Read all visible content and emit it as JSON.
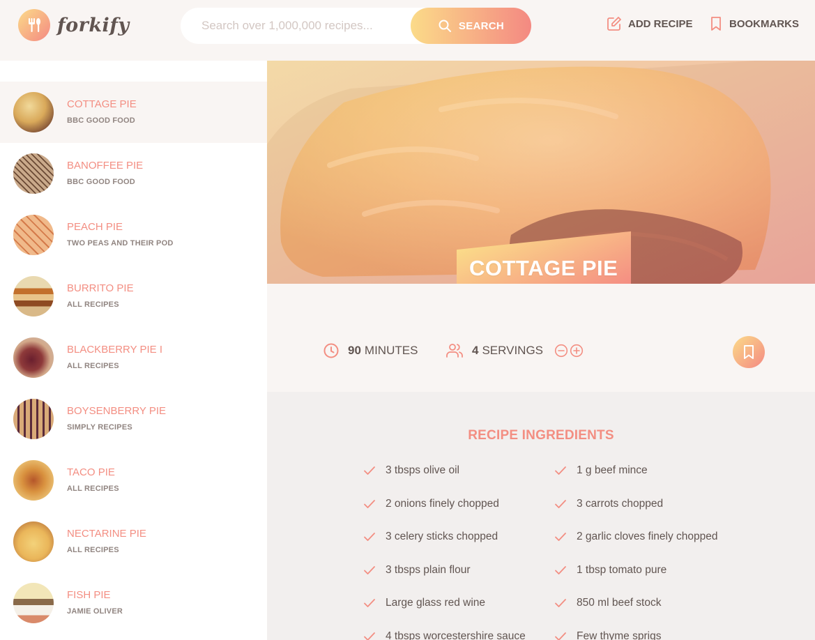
{
  "app": {
    "logo_text": "forkify"
  },
  "search": {
    "placeholder": "Search over 1,000,000 recipes...",
    "button_label": "SEARCH"
  },
  "nav": {
    "add_recipe": "ADD RECIPE",
    "bookmarks": "BOOKMARKS"
  },
  "results": [
    {
      "title": "COTTAGE PIE",
      "publisher": "BBC GOOD FOOD",
      "active": true
    },
    {
      "title": "BANOFFEE PIE",
      "publisher": "BBC GOOD FOOD"
    },
    {
      "title": "PEACH PIE",
      "publisher": "TWO PEAS AND THEIR POD"
    },
    {
      "title": "BURRITO PIE",
      "publisher": "ALL RECIPES"
    },
    {
      "title": "BLACKBERRY PIE I",
      "publisher": "ALL RECIPES"
    },
    {
      "title": "BOYSENBERRY PIE",
      "publisher": "SIMPLY RECIPES"
    },
    {
      "title": "TACO PIE",
      "publisher": "ALL RECIPES"
    },
    {
      "title": "NECTARINE PIE",
      "publisher": "ALL RECIPES"
    },
    {
      "title": "FISH PIE",
      "publisher": "JAMIE OLIVER"
    }
  ],
  "recipe": {
    "title": "COTTAGE PIE",
    "minutes": "90",
    "minutes_label": "MINUTES",
    "servings": "4",
    "servings_label": "SERVINGS",
    "ingredients_heading": "RECIPE INGREDIENTS",
    "ingredients_left": [
      "3 tbsps olive oil",
      "2 onions finely chopped",
      "3 celery sticks chopped",
      "3 tbsps plain flour",
      " Large glass red wine",
      "4 tbsps worcestershire sauce"
    ],
    "ingredients_right": [
      "1 g beef mince",
      "3 carrots chopped",
      "2 garlic cloves finely chopped",
      "1 tbsp tomato pure",
      "850 ml beef stock",
      " Few thyme sprigs"
    ]
  },
  "colors": {
    "accent": "#f38e82",
    "gradient_start": "#fbdb89",
    "gradient_end": "#f48982"
  }
}
